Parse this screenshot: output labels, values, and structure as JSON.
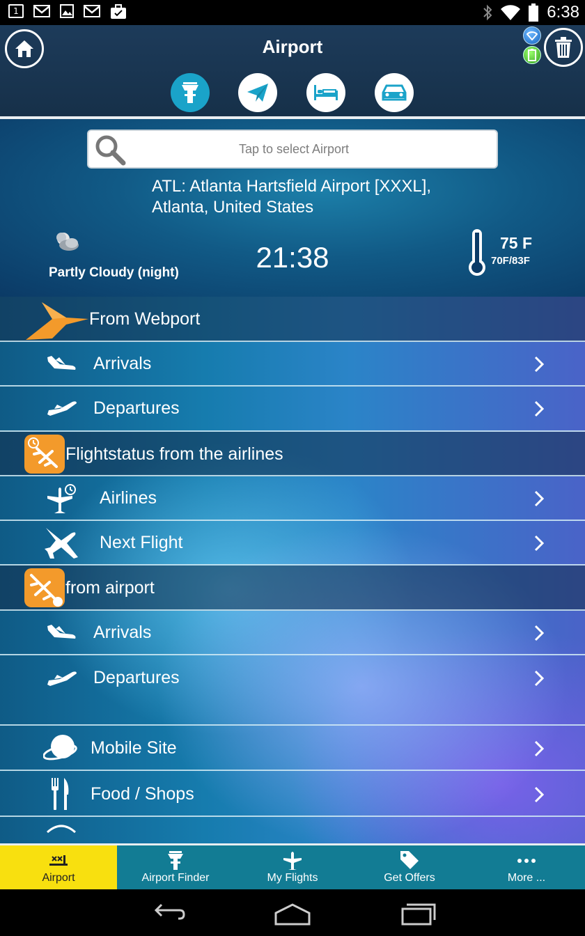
{
  "status_bar": {
    "time": "6:38",
    "notification_icons": [
      "sim-1-icon",
      "gmail-icon",
      "image-icon",
      "gmail-icon",
      "briefcase-icon"
    ],
    "system_icons": [
      "bluetooth-icon",
      "wifi-icon",
      "battery-icon"
    ]
  },
  "header": {
    "title": "Airport",
    "tabs": [
      "airport-tower-icon",
      "paper-plane-icon",
      "hotel-bed-icon",
      "car-icon"
    ],
    "active_tab": 0
  },
  "search": {
    "placeholder": "Tap to select Airport"
  },
  "airport": {
    "line1": "ATL: Atlanta Hartsfield Airport [XXXL],",
    "line2": "Atlanta, United States"
  },
  "weather": {
    "condition": "Partly Cloudy (night)",
    "time": "21:38",
    "temperature": "75 F",
    "range": "70F/83F"
  },
  "menu": {
    "webport_header": "From Webport",
    "webport_arrivals": "Arrivals",
    "webport_departures": "Departures",
    "flightstatus_header": "Flightstatus from the airlines",
    "airlines": "Airlines",
    "next_flight": "Next Flight",
    "from_airport_header": "from airport",
    "airport_arrivals": "Arrivals",
    "airport_departures": "Departures",
    "mobile_site": "Mobile Site",
    "food_shops": "Food / Shops"
  },
  "bottom_tabs": [
    {
      "label": "Airport",
      "icon": "runway-icon"
    },
    {
      "label": "Airport Finder",
      "icon": "tower-icon"
    },
    {
      "label": "My Flights",
      "icon": "plane-icon"
    },
    {
      "label": "Get Offers",
      "icon": "tag-icon"
    },
    {
      "label": "More ...",
      "icon": "more-dots-icon"
    }
  ],
  "colors": {
    "header_bg": "#1d3b5a",
    "active_tab": "#1aa3c9",
    "bottom_bar": "#127c94",
    "bottom_active": "#f8e00f",
    "section_icon_orange": "#f39a2b"
  }
}
